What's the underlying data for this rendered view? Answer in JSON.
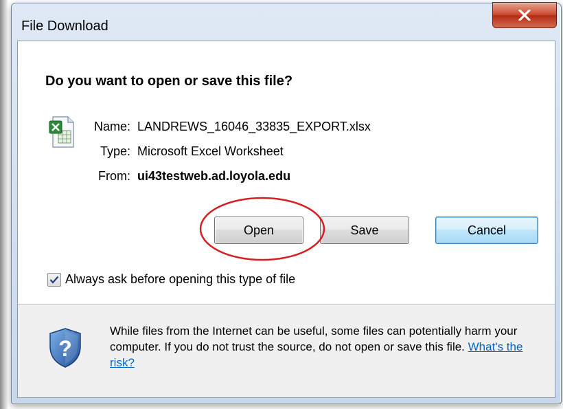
{
  "dialog": {
    "title": "File Download",
    "question": "Do you want to open or save this file?"
  },
  "file": {
    "name_label": "Name:",
    "name_value": "LANDREWS_16046_33835_EXPORT.xlsx",
    "type_label": "Type:",
    "type_value": "Microsoft Excel Worksheet",
    "from_label": "From:",
    "from_value": "ui43testweb.ad.loyola.edu",
    "icon": "excel-file-icon"
  },
  "buttons": {
    "open": "Open",
    "save": "Save",
    "cancel": "Cancel"
  },
  "checkbox": {
    "label": "Always ask before opening this type of file",
    "checked": true
  },
  "warning": {
    "text": "While files from the Internet can be useful, some files can potentially harm your computer. If you do not trust the source, do not open or save this file.",
    "link": "What's the risk?",
    "icon": "shield-question-icon"
  },
  "colors": {
    "close_button": "#c9452b",
    "callout_circle": "#d42020",
    "link": "#0066cc",
    "cancel_focus": "#3c7fb1"
  }
}
